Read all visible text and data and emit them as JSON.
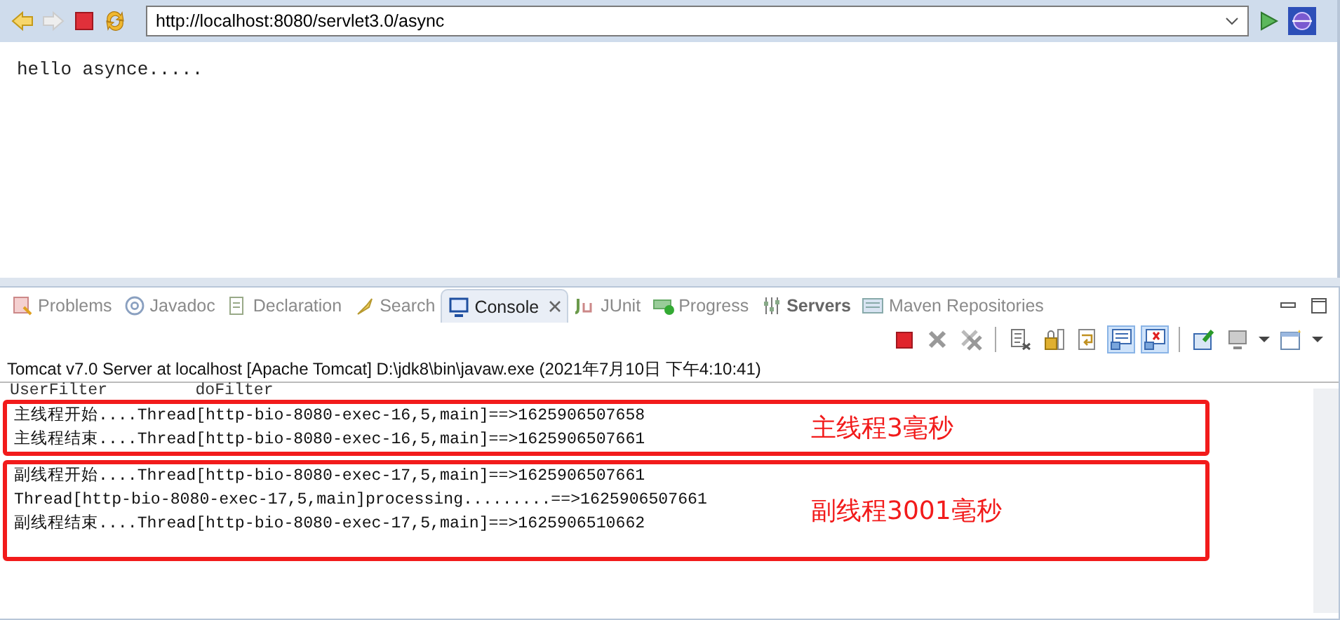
{
  "browser": {
    "url": "http://localhost:8080/servlet3.0/async",
    "page_text": "hello asynce....."
  },
  "view_tabs": [
    {
      "kind": "problems",
      "label": "Problems",
      "selected": false,
      "highlighted": false
    },
    {
      "kind": "javadoc",
      "label": "Javadoc",
      "selected": false,
      "highlighted": false
    },
    {
      "kind": "declaration",
      "label": "Declaration",
      "selected": false,
      "highlighted": false
    },
    {
      "kind": "search",
      "label": "Search",
      "selected": false,
      "highlighted": false
    },
    {
      "kind": "console",
      "label": "Console",
      "selected": true,
      "highlighted": false
    },
    {
      "kind": "junit",
      "label": "JUnit",
      "selected": false,
      "highlighted": false
    },
    {
      "kind": "progress",
      "label": "Progress",
      "selected": false,
      "highlighted": false
    },
    {
      "kind": "servers",
      "label": "Servers",
      "selected": false,
      "highlighted": true
    },
    {
      "kind": "maven",
      "label": "Maven Repositories",
      "selected": false,
      "highlighted": false
    }
  ],
  "console_toolbar": [
    {
      "kind": "stop"
    },
    {
      "kind": "remove"
    },
    {
      "kind": "remove-all"
    },
    {
      "kind": "separator"
    },
    {
      "kind": "clear"
    },
    {
      "kind": "scroll-lock"
    },
    {
      "kind": "word-wrap"
    },
    {
      "kind": "show-stdout",
      "pressed": true
    },
    {
      "kind": "show-stderr",
      "pressed": true
    },
    {
      "kind": "separator"
    },
    {
      "kind": "pin"
    },
    {
      "kind": "display"
    },
    {
      "kind": "dropdown"
    },
    {
      "kind": "new-console"
    },
    {
      "kind": "dropdown"
    }
  ],
  "console": {
    "header": "Tomcat v7.0 Server at localhost [Apache Tomcat] D:\\jdk8\\bin\\javaw.exe (2021年7月10日 下午4:10:41)",
    "lines": [
      "UserFilter         doFilter"
    ],
    "annotated_groups": [
      {
        "note": "主线程3毫秒",
        "lines": [
          "主线程开始....Thread[http-bio-8080-exec-16,5,main]==>1625906507658",
          "主线程结束....Thread[http-bio-8080-exec-16,5,main]==>1625906507661"
        ]
      },
      {
        "note": "副线程3001毫秒",
        "lines": [
          "副线程开始....Thread[http-bio-8080-exec-17,5,main]==>1625906507661",
          "Thread[http-bio-8080-exec-17,5,main]processing.........==>1625906507661",
          "副线程结束....Thread[http-bio-8080-exec-17,5,main]==>1625906510662"
        ]
      }
    ]
  }
}
